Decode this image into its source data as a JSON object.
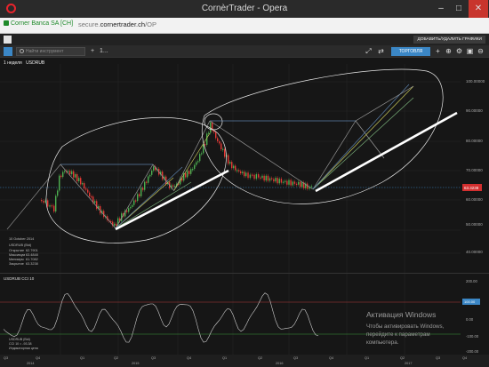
{
  "window": {
    "title": "CornèrTrader - Opera",
    "min": "–",
    "max": "□",
    "close": "✕"
  },
  "address_bar": {
    "site": "Corner Banca SA [CH]",
    "url_prefix": "secure.",
    "url_domain": "cornertrader.ch",
    "url_path": "/OP"
  },
  "app_toolbar": {
    "add_remove_charts": "ДОБАВИТЬ/УДАЛИТЬ ГРАФИКИ"
  },
  "chart_toolbar": {
    "search_placeholder": "Найти инструмент",
    "plus": "+",
    "timeframe": "1...",
    "trade_button": "ТОРГОВЛЯ"
  },
  "chart_header": {
    "timeframe": "1 неделя",
    "instrument": "USDRUB"
  },
  "side_info": {
    "date": "10 October 2014",
    "symbol": "USDRUB (Bid)",
    "rows": [
      {
        "label": "Открытие",
        "value": "62.7901"
      },
      {
        "label": "Максимум",
        "value": "63.4848"
      },
      {
        "label": "Минимум",
        "value": "61.7082"
      },
      {
        "label": "Закрытие",
        "value": "63.3238"
      }
    ]
  },
  "price_axis": {
    "ticks": [
      "100.00000",
      "90.00000",
      "80.00000",
      "70.00000",
      "60.00000",
      "50.00000",
      "40.00000"
    ],
    "current_price": "63.3238",
    "current_value": 63.3238,
    "range": [
      35,
      105
    ]
  },
  "indicator": {
    "title": "USDRUB  CCI 10",
    "ticks": [
      "200.00",
      "100.00",
      "0.00",
      "-100.00",
      "-200.00"
    ],
    "current_label": "100.00",
    "current_high": "150.00",
    "legend_lines": [
      "USDRUB (Bid)",
      "CCI  10  =  -93.38",
      "Индикаторная цена"
    ]
  },
  "time_axis": {
    "years": [
      "2014",
      "2015",
      "2016",
      "2017"
    ],
    "quarters": [
      "Q3",
      "Q4",
      "Q1",
      "Q2",
      "Q3",
      "Q4",
      "Q1",
      "Q2",
      "Q3",
      "Q4",
      "Q1",
      "Q2",
      "Q3",
      "Q4"
    ]
  },
  "watermark": {
    "title": "Активация Windows",
    "line1": "Чтобы активировать Windows,",
    "line2": "перейдите к параметрам",
    "line3": "компьютера."
  },
  "colors": {
    "up": "#4caf50",
    "down": "#e53935",
    "accent": "#3b87c6",
    "price_tag": "#d32f2f",
    "trend_line": "#ffffff"
  },
  "icons": [
    "opera-icon",
    "lock-icon",
    "pencil-icon",
    "search-icon",
    "cursor-icon",
    "crosshair-icon",
    "zoom-icon",
    "settings-icon"
  ]
}
